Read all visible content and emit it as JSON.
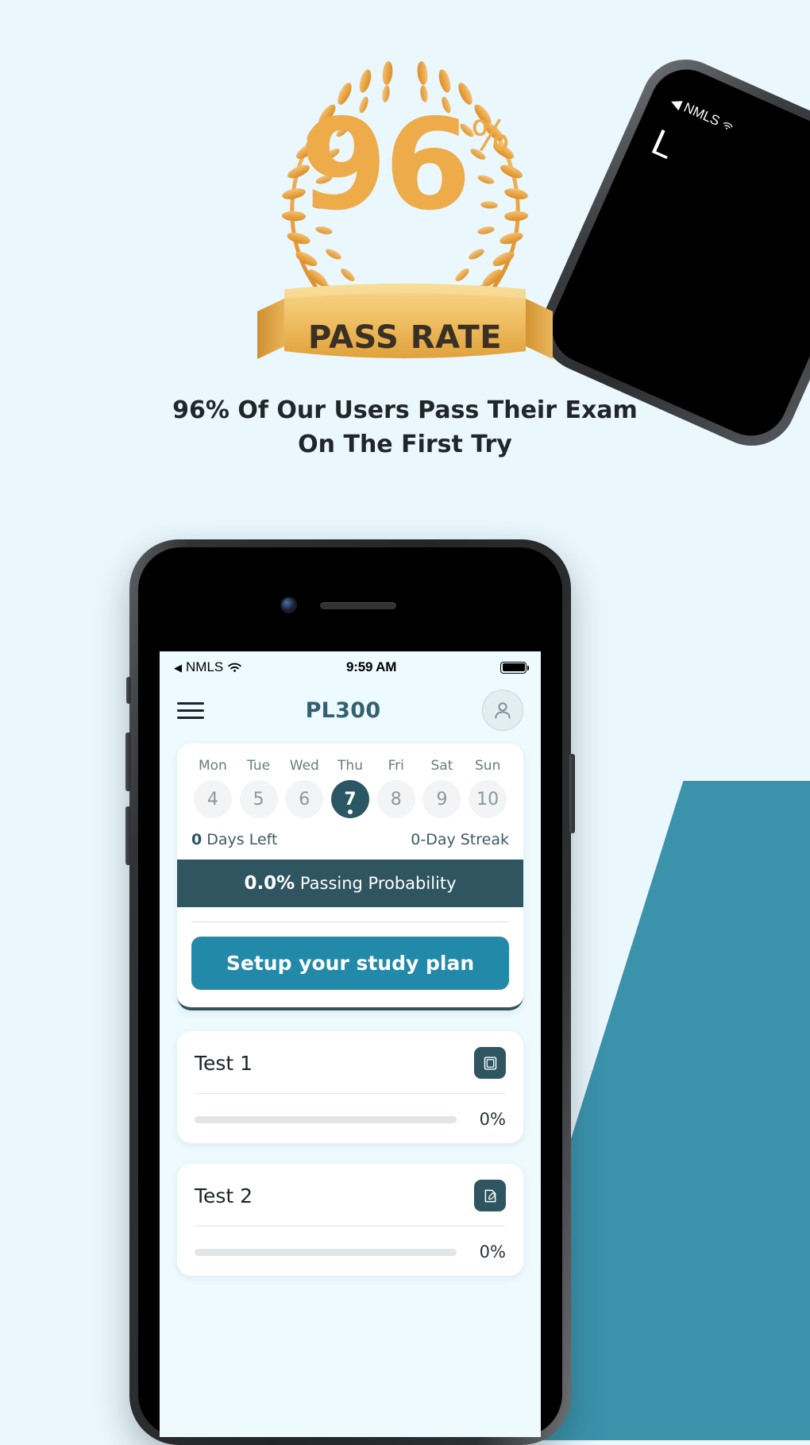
{
  "hero": {
    "percent_number": "96",
    "percent_symbol": "%",
    "ribbon_label": "PASS RATE",
    "tagline": "96% Of Our Users Pass Their Exam On The First Try",
    "laurel_color": "#edab4a",
    "ribbon_color": "#f0c668"
  },
  "tilted_phone": {
    "status_carrier": "NMLS",
    "body_text": "L"
  },
  "phone": {
    "status_bar": {
      "back_caret": "◀",
      "carrier": "NMLS",
      "wifi_icon": "wifi-icon",
      "time": "9:59 AM",
      "battery_icon": "battery-full-icon"
    },
    "header": {
      "menu_icon": "hamburger-menu-icon",
      "title": "PL300",
      "avatar_icon": "user-avatar-icon"
    },
    "plan_card": {
      "week": [
        {
          "name": "Mon",
          "date": "4",
          "active": false
        },
        {
          "name": "Tue",
          "date": "5",
          "active": false
        },
        {
          "name": "Wed",
          "date": "6",
          "active": false
        },
        {
          "name": "Thu",
          "date": "7",
          "active": true
        },
        {
          "name": "Fri",
          "date": "8",
          "active": false
        },
        {
          "name": "Sat",
          "date": "9",
          "active": false
        },
        {
          "name": "Sun",
          "date": "10",
          "active": false
        }
      ],
      "days_left_value": "0",
      "days_left_label": " Days Left",
      "streak_label": "0-Day Streak",
      "probability_value": "0.0%",
      "probability_label": " Passing Probability",
      "cta_label": "Setup your study plan",
      "banner_color": "#2f5560",
      "cta_color": "#2389a8"
    },
    "tests": [
      {
        "name": "Test 1",
        "progress": 0,
        "progress_label": "0%",
        "icon": "book-icon"
      },
      {
        "name": "Test 2",
        "progress": 0,
        "progress_label": "0%",
        "icon": "edit-note-icon"
      }
    ]
  }
}
